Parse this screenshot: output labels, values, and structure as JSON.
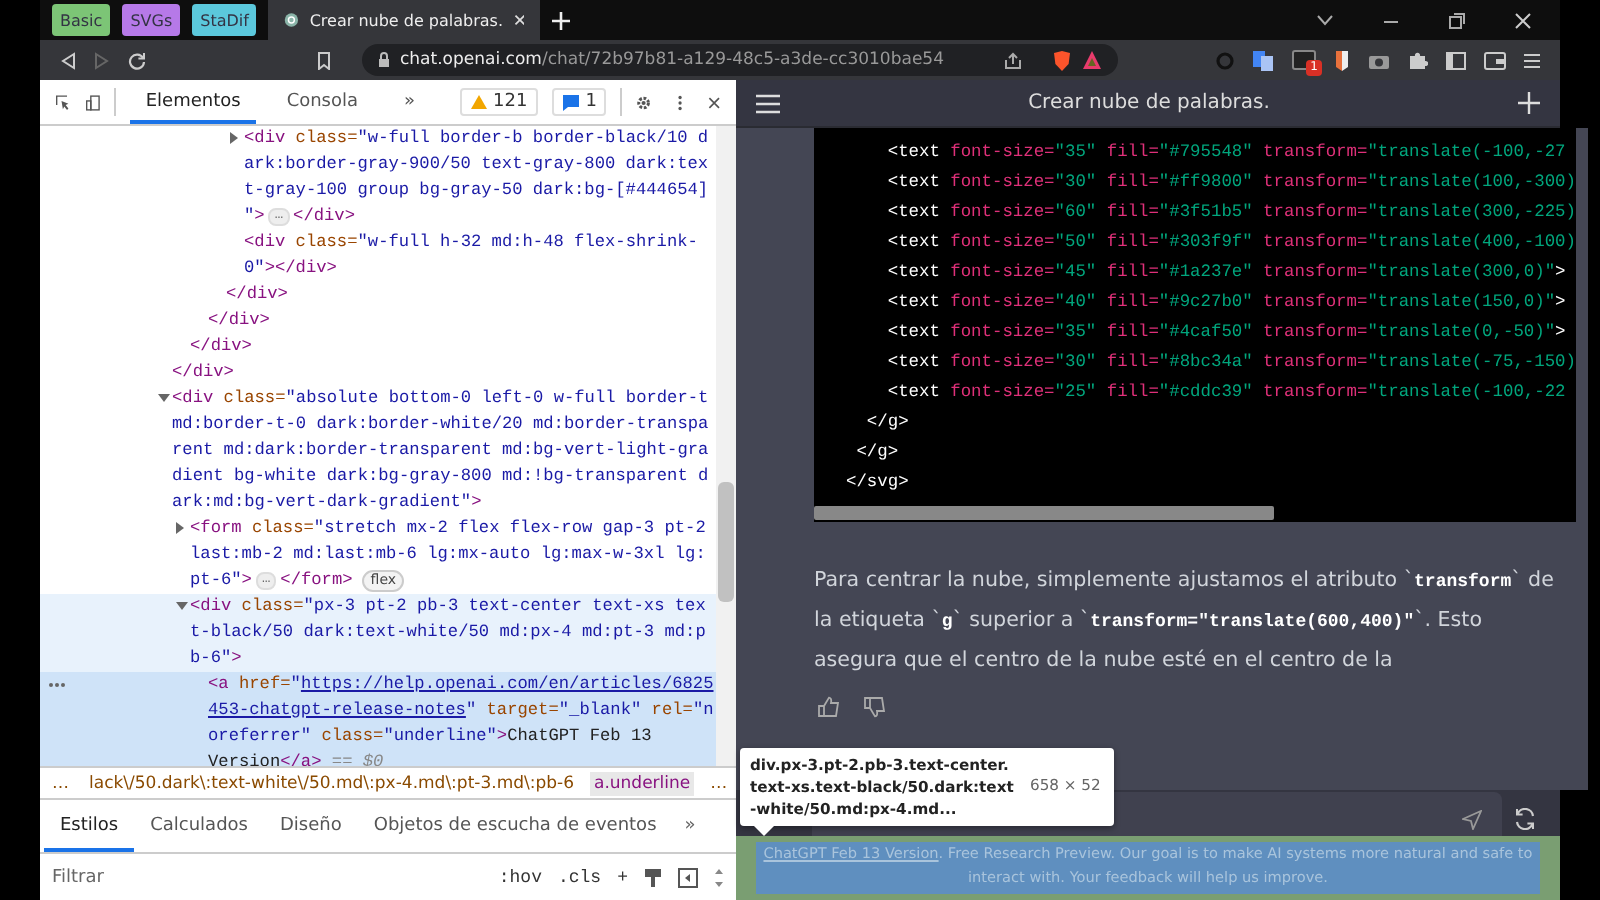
{
  "browser": {
    "bookmarks": [
      {
        "label": "Basic",
        "color": "#7cc576"
      },
      {
        "label": "SVGs",
        "color": "#b679e8"
      },
      {
        "label": "StaDif",
        "color": "#5bc8dc"
      }
    ],
    "tabs": [
      {
        "title": "Crear nube de palabras.",
        "selected": true
      }
    ],
    "url": {
      "host": "chat.openai.com",
      "path": "/chat/72b97b81-a129-48c5-a3de-cc3010bae54"
    },
    "extension_badge": "1"
  },
  "devtools": {
    "tabs": [
      {
        "label": "Elementos",
        "selected": true
      },
      {
        "label": "Consola",
        "selected": false
      }
    ],
    "more": "»",
    "warnings": "121",
    "messages": "1",
    "tree": [
      {
        "close": [
          {
            "kind": "tag",
            "text": "</div>"
          }
        ],
        "children": [
          {
            "close": [
              {
                "kind": "tag",
                "text": "</div>"
              }
            ],
            "children": [
              {
                "close": [
                  {
                    "kind": "tag",
                    "text": "</div>"
                  }
                ],
                "children": [
                  {
                    "close": [
                      {
                        "kind": "tag",
                        "text": "</div>"
                      }
                    ],
                    "children": [
                      {
                        "expanded": false,
                        "selected": false,
                        "hovered": false,
                        "lines": [
                          [
                            {
                              "kind": "tag",
                              "text": "<div"
                            },
                            {
                              "kind": "attr",
                              "text": " class="
                            },
                            {
                              "kind": "value",
                              "text": "\"w-full border-b border-black/10 d"
                            }
                          ],
                          [
                            {
                              "kind": "value",
                              "text": "ark:border-gray-900/50 text-gray-800 dark:tex"
                            }
                          ],
                          [
                            {
                              "kind": "value",
                              "text": "t-gray-100 group bg-gray-50 dark:bg-[#444654]"
                            }
                          ],
                          [
                            {
                              "kind": "value",
                              "text": "\""
                            },
                            {
                              "kind": "tag",
                              "text": ">"
                            },
                            {
                              "kind": "ellipsis",
                              "text": "…"
                            },
                            {
                              "kind": "tag",
                              "text": "</div>"
                            }
                          ]
                        ]
                      },
                      {
                        "selected": false,
                        "hovered": false,
                        "lines": [
                          [
                            {
                              "kind": "tag",
                              "text": "<div"
                            },
                            {
                              "kind": "attr",
                              "text": " class="
                            },
                            {
                              "kind": "value",
                              "text": "\"w-full h-32 md:h-48 flex-shrink-"
                            }
                          ],
                          [
                            {
                              "kind": "value",
                              "text": "0\""
                            },
                            {
                              "kind": "tag",
                              "text": "></div>"
                            }
                          ]
                        ]
                      }
                    ]
                  }
                ]
              }
            ]
          }
        ]
      },
      {
        "expanded": true,
        "selected": false,
        "hovered": false,
        "lines": [
          [
            {
              "kind": "tag",
              "text": "<div"
            },
            {
              "kind": "attr",
              "text": " class="
            },
            {
              "kind": "value",
              "text": "\"absolute bottom-0 left-0 w-full border-t"
            }
          ],
          [
            {
              "kind": "value",
              "text": "md:border-t-0 dark:border-white/20 md:border-transpa"
            }
          ],
          [
            {
              "kind": "value",
              "text": "rent md:dark:border-transparent md:bg-vert-light-gra"
            }
          ],
          [
            {
              "kind": "value",
              "text": "dient bg-white dark:bg-gray-800 md:!bg-transparent d"
            }
          ],
          [
            {
              "kind": "value",
              "text": "ark:md:bg-vert-dark-gradient\""
            },
            {
              "kind": "tag",
              "text": ">"
            }
          ]
        ],
        "children": [
          {
            "expanded": false,
            "selected": false,
            "hovered": false,
            "lines": [
              [
                {
                  "kind": "tag",
                  "text": "<form"
                },
                {
                  "kind": "attr",
                  "text": " class="
                },
                {
                  "kind": "value",
                  "text": "\"stretch mx-2 flex flex-row gap-3 pt-2"
                }
              ],
              [
                {
                  "kind": "value",
                  "text": "last:mb-2 md:last:mb-6 lg:mx-auto lg:max-w-3xl lg:"
                }
              ],
              [
                {
                  "kind": "value",
                  "text": "pt-6\""
                },
                {
                  "kind": "tag",
                  "text": ">"
                },
                {
                  "kind": "ellipsis",
                  "text": "…"
                },
                {
                  "kind": "tag",
                  "text": "</form>"
                },
                {
                  "kind": "badge",
                  "text": "flex"
                }
              ]
            ]
          },
          {
            "expanded": true,
            "selected": false,
            "hovered": true,
            "lines": [
              [
                {
                  "kind": "tag",
                  "text": "<div"
                },
                {
                  "kind": "attr",
                  "text": " class="
                },
                {
                  "kind": "value",
                  "text": "\"px-3 pt-2 pb-3 text-center text-xs tex"
                }
              ],
              [
                {
                  "kind": "value",
                  "text": "t-black/50 dark:text-white/50 md:px-4 md:pt-3 md:p"
                }
              ],
              [
                {
                  "kind": "value",
                  "text": "b-6\""
                },
                {
                  "kind": "tag",
                  "text": ">"
                }
              ]
            ],
            "children": [
              {
                "selected": true,
                "hovered": false,
                "lines": [
                  [
                    {
                      "kind": "tag",
                      "text": "<a"
                    },
                    {
                      "kind": "attr",
                      "text": " href="
                    },
                    {
                      "kind": "value",
                      "text": "\""
                    },
                    {
                      "kind": "link",
                      "text": "https://help.openai.com/en/articles/6825"
                    }
                  ],
                  [
                    {
                      "kind": "link",
                      "text": "453-chatgpt-release-notes"
                    },
                    {
                      "kind": "value",
                      "text": "\""
                    },
                    {
                      "kind": "attr",
                      "text": " target="
                    },
                    {
                      "kind": "value",
                      "text": "\"_blank\""
                    },
                    {
                      "kind": "attr",
                      "text": " rel="
                    },
                    {
                      "kind": "value",
                      "text": "\"n"
                    }
                  ],
                  [
                    {
                      "kind": "value",
                      "text": "oreferrer\""
                    },
                    {
                      "kind": "attr",
                      "text": " class="
                    },
                    {
                      "kind": "value",
                      "text": "\"underline\""
                    },
                    {
                      "kind": "tag",
                      "text": ">"
                    },
                    {
                      "kind": "text",
                      "text": "ChatGPT Feb 13"
                    }
                  ],
                  [
                    {
                      "kind": "text",
                      "text": "Version"
                    },
                    {
                      "kind": "tag",
                      "text": "</a>"
                    },
                    {
                      "kind": "note",
                      "text": " == $0"
                    }
                  ]
                ]
              }
            ]
          }
        ]
      }
    ],
    "breadcrumbs": [
      {
        "label": "…",
        "selected": false
      },
      {
        "label": "lack\\/50.dark\\:text-white\\/50.md\\:px-4.md\\:pt-3.md\\:pb-6",
        "selected": false
      },
      {
        "label": "a.underline",
        "selected": true
      },
      {
        "label": "…",
        "selected": false
      }
    ],
    "styles_tabs": [
      {
        "label": "Estilos",
        "selected": true
      },
      {
        "label": "Calculados",
        "selected": false
      },
      {
        "label": "Diseño",
        "selected": false
      },
      {
        "label": "Objetos de escucha de eventos",
        "selected": false
      }
    ],
    "styles_more": "»",
    "filter": {
      "placeholder": "Filtrar"
    },
    "filter_buttons": [
      ":hov",
      ".cls",
      "+"
    ]
  },
  "chat": {
    "title": "Crear nube de palabras.",
    "code": [
      [
        {
          "kind": "tag",
          "text": "    <text"
        },
        {
          "kind": "attr",
          "text": " font-size="
        },
        {
          "kind": "value",
          "text": "\"35\""
        },
        {
          "kind": "attr",
          "text": " fill="
        },
        {
          "kind": "value",
          "text": "\"#795548\""
        },
        {
          "kind": "attr",
          "text": " transform="
        },
        {
          "kind": "value",
          "text": "\"translate(-100,-27"
        }
      ],
      [
        {
          "kind": "tag",
          "text": "    <text"
        },
        {
          "kind": "attr",
          "text": " font-size="
        },
        {
          "kind": "value",
          "text": "\"30\""
        },
        {
          "kind": "attr",
          "text": " fill="
        },
        {
          "kind": "value",
          "text": "\"#ff9800\""
        },
        {
          "kind": "attr",
          "text": " transform="
        },
        {
          "kind": "value",
          "text": "\"translate(100,-300)"
        }
      ],
      [
        {
          "kind": "tag",
          "text": "    <text"
        },
        {
          "kind": "attr",
          "text": " font-size="
        },
        {
          "kind": "value",
          "text": "\"60\""
        },
        {
          "kind": "attr",
          "text": " fill="
        },
        {
          "kind": "value",
          "text": "\"#3f51b5\""
        },
        {
          "kind": "attr",
          "text": " transform="
        },
        {
          "kind": "value",
          "text": "\"translate(300,-225)"
        }
      ],
      [
        {
          "kind": "tag",
          "text": "    <text"
        },
        {
          "kind": "attr",
          "text": " font-size="
        },
        {
          "kind": "value",
          "text": "\"50\""
        },
        {
          "kind": "attr",
          "text": " fill="
        },
        {
          "kind": "value",
          "text": "\"#303f9f\""
        },
        {
          "kind": "attr",
          "text": " transform="
        },
        {
          "kind": "value",
          "text": "\"translate(400,-100)"
        }
      ],
      [
        {
          "kind": "tag",
          "text": "    <text"
        },
        {
          "kind": "attr",
          "text": " font-size="
        },
        {
          "kind": "value",
          "text": "\"45\""
        },
        {
          "kind": "attr",
          "text": " fill="
        },
        {
          "kind": "value",
          "text": "\"#1a237e\""
        },
        {
          "kind": "attr",
          "text": " transform="
        },
        {
          "kind": "value",
          "text": "\"translate(300,0)\""
        },
        {
          "kind": "tag",
          "text": ">"
        }
      ],
      [
        {
          "kind": "tag",
          "text": "    <text"
        },
        {
          "kind": "attr",
          "text": " font-size="
        },
        {
          "kind": "value",
          "text": "\"40\""
        },
        {
          "kind": "attr",
          "text": " fill="
        },
        {
          "kind": "value",
          "text": "\"#9c27b0\""
        },
        {
          "kind": "attr",
          "text": " transform="
        },
        {
          "kind": "value",
          "text": "\"translate(150,0)\""
        },
        {
          "kind": "tag",
          "text": ">"
        }
      ],
      [
        {
          "kind": "tag",
          "text": "    <text"
        },
        {
          "kind": "attr",
          "text": " font-size="
        },
        {
          "kind": "value",
          "text": "\"35\""
        },
        {
          "kind": "attr",
          "text": " fill="
        },
        {
          "kind": "value",
          "text": "\"#4caf50\""
        },
        {
          "kind": "attr",
          "text": " transform="
        },
        {
          "kind": "value",
          "text": "\"translate(0,-50)\""
        },
        {
          "kind": "tag",
          "text": ">"
        }
      ],
      [
        {
          "kind": "tag",
          "text": "    <text"
        },
        {
          "kind": "attr",
          "text": " font-size="
        },
        {
          "kind": "value",
          "text": "\"30\""
        },
        {
          "kind": "attr",
          "text": " fill="
        },
        {
          "kind": "value",
          "text": "\"#8bc34a\""
        },
        {
          "kind": "attr",
          "text": " transform="
        },
        {
          "kind": "value",
          "text": "\"translate(-75,-150)"
        }
      ],
      [
        {
          "kind": "tag",
          "text": "    <text"
        },
        {
          "kind": "attr",
          "text": " font-size="
        },
        {
          "kind": "value",
          "text": "\"25\""
        },
        {
          "kind": "attr",
          "text": " fill="
        },
        {
          "kind": "value",
          "text": "\"#cddc39\""
        },
        {
          "kind": "attr",
          "text": " transform="
        },
        {
          "kind": "value",
          "text": "\"translate(-100,-22"
        }
      ],
      [
        {
          "kind": "tag",
          "text": "  </g>"
        }
      ],
      [
        {
          "kind": "tag",
          "text": " </g>"
        }
      ],
      [
        {
          "kind": "tag",
          "text": "</svg>"
        }
      ]
    ],
    "message": "Para centrar la nube, simplemente ajustamos el atributo `**transform**` de la etiqueta `**g**` superior a `**transform=\"translate(600,400)\"**`. Esto asegura que el centro de la nube esté en el centro de la",
    "tooltip": {
      "selector": "div.px-3.pt-2.pb-3.text-center.text-xs.text-black/50.dark:text-white/50.md:px-4.md...",
      "size": "658 × 52"
    },
    "footer": {
      "link": "ChatGPT Feb 13 Version",
      "text": ". Free Research Preview. Our goal is to make AI systems more natural and safe to interact with. Your feedback will help us improve."
    }
  }
}
